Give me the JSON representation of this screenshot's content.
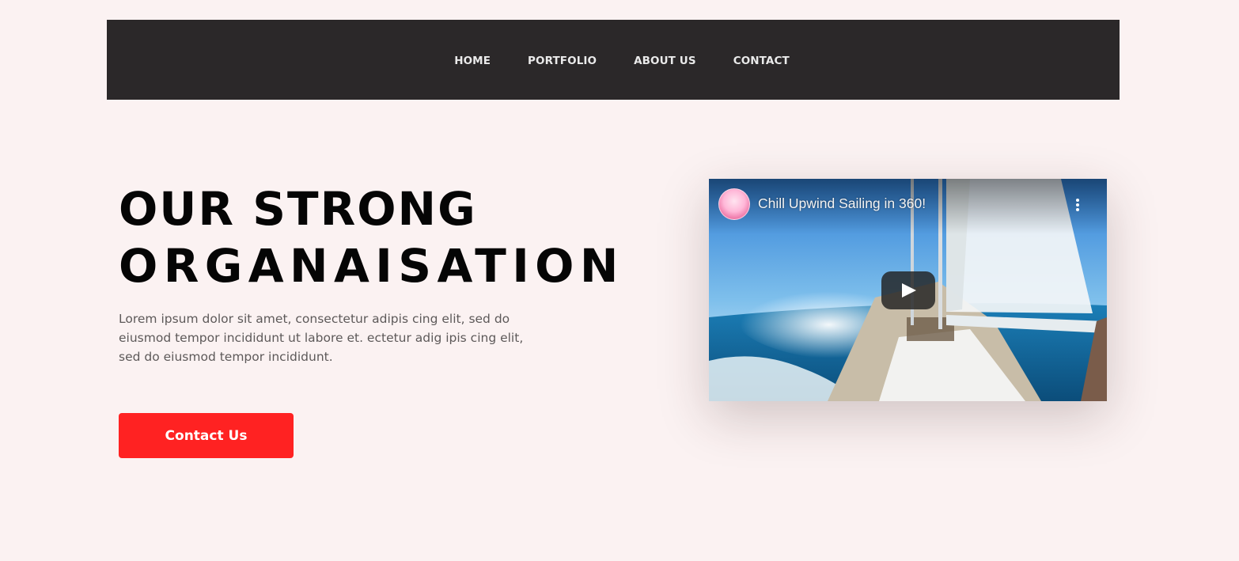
{
  "nav": {
    "items": [
      {
        "label": "HOME"
      },
      {
        "label": "PORTFOLIO"
      },
      {
        "label": "ABOUT US"
      },
      {
        "label": "CONTACT"
      }
    ]
  },
  "hero": {
    "title_line1": "OUR STRONG",
    "title_line2": "ORGANAISATION",
    "description": "Lorem ipsum dolor sit amet, consectetur adipis cing elit, sed do eiusmod tempor incididunt ut labore et. ectetur adig ipis cing elit, sed do eiusmod tempor incididunt.",
    "cta_label": "Contact Us"
  },
  "video": {
    "title": "Chill Upwind Sailing in 360!",
    "channel_avatar_icon": "meditation-avatar-icon",
    "menu_icon": "more-vertical-icon",
    "play_icon": "youtube-play-icon"
  },
  "colors": {
    "page_background": "#fbf2f2",
    "navbar": "#2b2829",
    "accent": "#ff2222",
    "heading": "#050505",
    "body_text": "#5d5959"
  }
}
